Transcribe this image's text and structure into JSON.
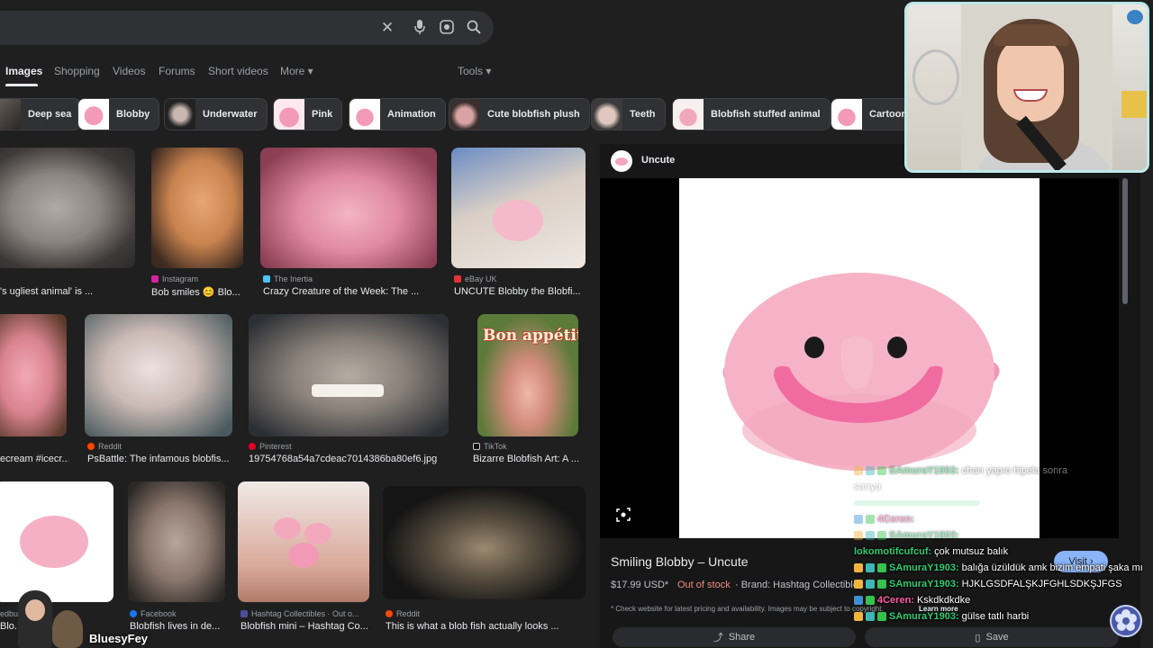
{
  "search": {
    "clear_icon": "close-icon",
    "mic_icon": "mic-icon",
    "lens_icon": "lens-icon",
    "search_icon": "search-icon"
  },
  "tabs": [
    {
      "label": "Images",
      "active": true
    },
    {
      "label": "Shopping"
    },
    {
      "label": "Videos"
    },
    {
      "label": "Forums"
    },
    {
      "label": "Short videos"
    },
    {
      "label": "More ▾"
    }
  ],
  "tools_label": "Tools ▾",
  "chips": [
    "Deep sea",
    "Blobby",
    "Underwater",
    "Pink",
    "Animation",
    "Cute blobfish plush",
    "Teeth",
    "Blobfish stuffed animal",
    "Cartoon"
  ],
  "results": {
    "r1": {
      "src": "",
      "cap": "'s ugliest animal' is ..."
    },
    "r2": {
      "src": "Instagram",
      "cap": "Bob smiles 😊 Blo..."
    },
    "r3": {
      "src": "The Inertia",
      "cap": "Crazy Creature of the Week: The ..."
    },
    "r4": {
      "src": "eBay UK",
      "cap": "UNCUTE Blobby the Blobfi..."
    },
    "r5": {
      "src": "",
      "cap": "ecream #icecr..."
    },
    "r6": {
      "src": "Reddit",
      "cap": "PsBattle: The infamous blobfis..."
    },
    "r7": {
      "src": "Pinterest",
      "cap": "19754768a54a7cdeac7014386ba80ef6.jpg"
    },
    "r8": {
      "src": "TikTok",
      "cap": "Bizarre Blobfish Art: A ...",
      "overlay": "Bon appétit"
    },
    "r9": {
      "src": "edbu   n stock",
      "cap": "Blo...         Photo..."
    },
    "r10": {
      "src": "Facebook",
      "cap": "Blobfish lives in de..."
    },
    "r11": {
      "src": "Hashtag Collectibles · Out o...",
      "cap": "Blobfish mini – Hashtag Co..."
    },
    "r12": {
      "src": "Reddit",
      "cap": "This is what a blob fish actually looks ..."
    }
  },
  "panel": {
    "site": "Uncute",
    "title": "Smiling Blobby – Uncute",
    "price": "$17.99 USD*",
    "stock": "Out of stock",
    "brand": "· Brand: Hashtag Collectibles",
    "disclaimer": "* Check website for latest pricing and availability. Images may be subject to copyright.",
    "learn_more": "Learn more",
    "visit": "Visit ›",
    "share": "Share",
    "save": "Save"
  },
  "chat": [
    {
      "user": "SAmuraY1903:",
      "msg": "charı yapıo hipela sonra",
      "ucolor": "#2ecc71",
      "faded": true
    },
    {
      "user": "",
      "msg": "sarıya",
      "ucolor": "#2ecc71",
      "faded": true
    },
    {
      "user": "",
      "msg": "",
      "ucolor": "#2ecc71",
      "faded": true
    },
    {
      "user": "4Ceren:",
      "msg": "",
      "ucolor": "#ff5fa2",
      "faded": true
    },
    {
      "user": "SAmuraY1903:",
      "msg": "",
      "ucolor": "#2ecc71",
      "faded": true
    },
    {
      "user": "lokomotifcufcuf:",
      "msg": "çok mutsuz balık",
      "ucolor": "#2ecc71",
      "faded": false
    },
    {
      "user": "SAmuraY1903:",
      "msg": "balığa üzüldük amk bizim empati şaka mı",
      "ucolor": "#2ecc71",
      "faded": false
    },
    {
      "user": "SAmuraY1903:",
      "msg": "HJKLGSDFALŞKJFGHLSDKŞJFGS",
      "ucolor": "#2ecc71",
      "faded": false
    },
    {
      "user": "4Ceren:",
      "msg": "Kskdkdkdke",
      "ucolor": "#ff5fa2",
      "faded": false
    },
    {
      "user": "SAmuraY1903:",
      "msg": "gülse tatlı harbi",
      "ucolor": "#2ecc71",
      "faded": false
    }
  ],
  "streamer": {
    "name": "BluesyFey"
  },
  "colors": {
    "accent": "#8ab4f8",
    "stock_red": "#f28b82",
    "blob_pink": "#f4a6c0"
  }
}
